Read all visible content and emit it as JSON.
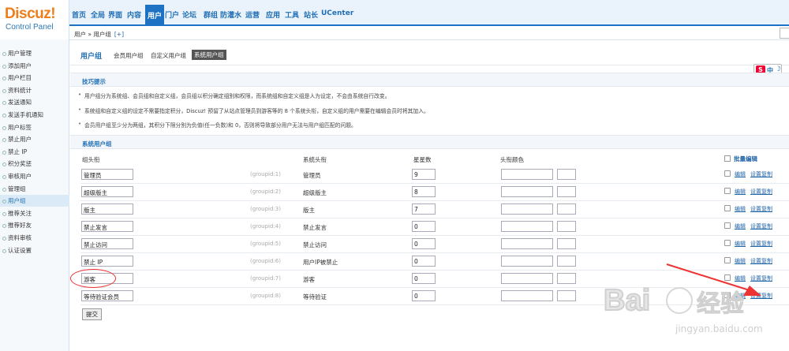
{
  "logo": {
    "title": "Discuz!",
    "subtitle": "Control Panel"
  },
  "topnav": [
    {
      "label": "首页",
      "active": false
    },
    {
      "label": "全局",
      "active": false
    },
    {
      "label": "界面",
      "active": false
    },
    {
      "label": "内容",
      "active": false
    },
    {
      "label": "用户",
      "active": true
    },
    {
      "label": "门户",
      "active": false
    },
    {
      "label": "论坛",
      "active": false
    },
    {
      "label": "群组",
      "active": false
    },
    {
      "label": "防灌水",
      "active": false
    },
    {
      "label": "运营",
      "active": false
    },
    {
      "label": "应用",
      "active": false
    },
    {
      "label": "工具",
      "active": false
    },
    {
      "label": "站长",
      "active": false
    },
    {
      "label": "UCenter",
      "active": false
    }
  ],
  "breadcrumb": {
    "text": "用户 » 用户组",
    "add": "[+]"
  },
  "sidebar": [
    {
      "label": "用户管理",
      "active": false
    },
    {
      "label": "添加用户",
      "active": false
    },
    {
      "label": "用户栏目",
      "active": false
    },
    {
      "label": "资料统计",
      "active": false
    },
    {
      "label": "发送通知",
      "active": false
    },
    {
      "label": "发送手机通知",
      "active": false
    },
    {
      "label": "用户标签",
      "active": false
    },
    {
      "label": "禁止用户",
      "active": false
    },
    {
      "label": "禁止 IP",
      "active": false
    },
    {
      "label": "积分奖惩",
      "active": false
    },
    {
      "label": "审核用户",
      "active": false
    },
    {
      "label": "管理组",
      "active": false
    },
    {
      "label": "用户组",
      "active": true
    },
    {
      "label": "推荐关注",
      "active": false
    },
    {
      "label": "推荐好友",
      "active": false
    },
    {
      "label": "资料审核",
      "active": false
    },
    {
      "label": "认证设置",
      "active": false
    }
  ],
  "page": {
    "title": "用户组",
    "tabs": [
      {
        "label": "会员用户组",
        "active": false
      },
      {
        "label": "自定义用户组",
        "active": false
      },
      {
        "label": "系统用户组",
        "active": true
      }
    ]
  },
  "ime": {
    "logo": "S",
    "lang": "中",
    "mode": "☽"
  },
  "tips": {
    "title": "技巧提示",
    "items": [
      "用户组分为系统组、会员组和自定义组，会员组以积分确定组别和权限，而系统组和自定义组是人为设定，不会由系统自行改变。",
      "系统组和自定义组的设定不需要指定积分，Discuz! 预留了从站点管理员到游客等的 8 个系统头衔，自定义组的用户需要在编辑会员时将其加入。",
      "会员用户组至少分为两组，其积分下限分别为负值(任一负数)和 0，否则将导致部分用户无法与用户组匹配的问题。"
    ]
  },
  "system_groups": {
    "title": "系统用户组",
    "columns": {
      "name": "组头衔",
      "system": "系统头衔",
      "stars": "星星数",
      "color": "头衔颜色",
      "bulk": "批量编辑"
    },
    "edit_label": "编辑",
    "copy_label": "设置复制",
    "submit_label": "提交",
    "rows": [
      {
        "name": "管理员",
        "gid": "(groupid:1)",
        "system": "管理员",
        "stars": "9"
      },
      {
        "name": "超级版主",
        "gid": "(groupid:2)",
        "system": "超级版主",
        "stars": "8"
      },
      {
        "name": "版主",
        "gid": "(groupid:3)",
        "system": "版主",
        "stars": "7"
      },
      {
        "name": "禁止发言",
        "gid": "(groupid:4)",
        "system": "禁止发言",
        "stars": "0"
      },
      {
        "name": "禁止访问",
        "gid": "(groupid:5)",
        "system": "禁止访问",
        "stars": "0"
      },
      {
        "name": "禁止 IP",
        "gid": "(groupid:6)",
        "system": "用户IP被禁止",
        "stars": "0"
      },
      {
        "name": "游客",
        "gid": "(groupid:7)",
        "system": "游客",
        "stars": "0"
      },
      {
        "name": "等待验证会员",
        "gid": "(groupid:8)",
        "system": "等待验证",
        "stars": "0"
      }
    ]
  },
  "annotation": {
    "color": "#e33333"
  },
  "colors": {
    "brand_orange": "#ee7d1b",
    "nav_blue": "#1d72c4",
    "link_blue": "#2366a8"
  }
}
